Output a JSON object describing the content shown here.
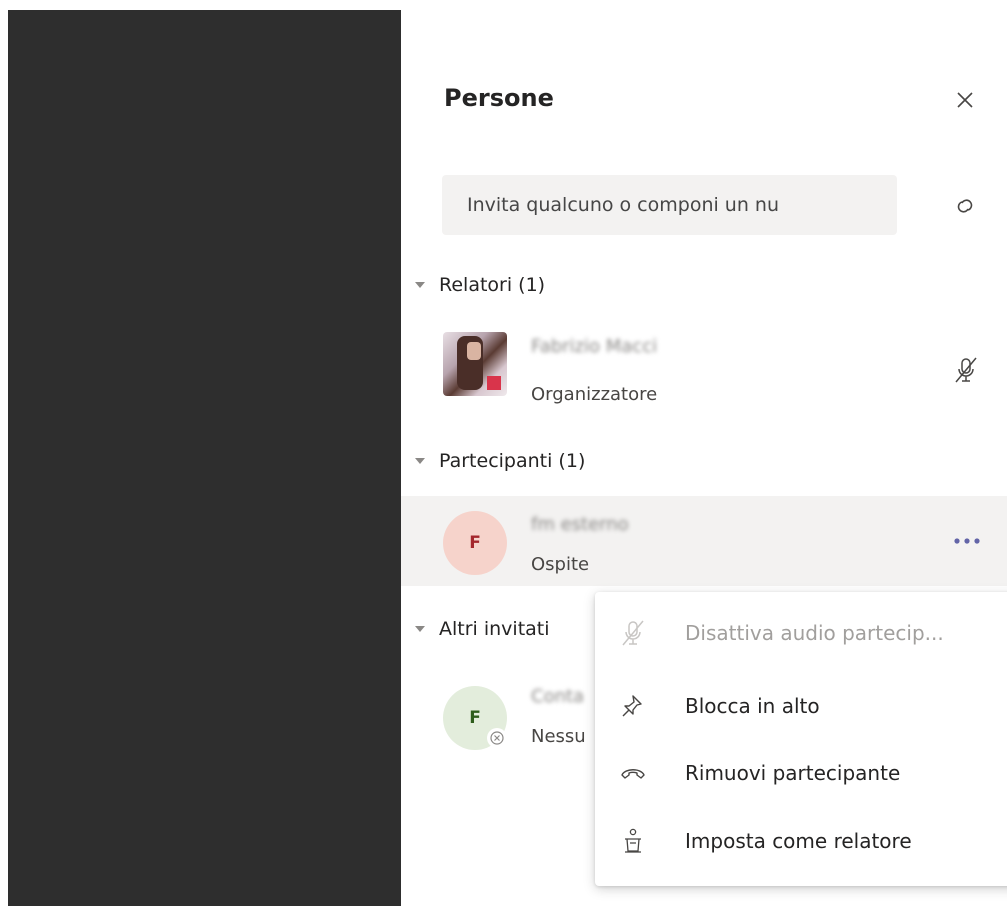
{
  "panel": {
    "title": "Persone",
    "search_placeholder": "Invita qualcuno o componi un nu"
  },
  "sections": {
    "presenters": {
      "label": "Relatori (1)"
    },
    "attendees": {
      "label": "Partecipanti (1)"
    },
    "others": {
      "label": "Altri invitati"
    }
  },
  "presenter": {
    "name": "Fabrizio Macci",
    "role": "Organizzatore"
  },
  "attendee": {
    "initial": "F",
    "name": "fm esterno",
    "role": "Ospite"
  },
  "other_invitee": {
    "initial": "F",
    "name": "Conta",
    "role": "Nessu"
  },
  "context_menu": {
    "items": [
      {
        "label": "Disattiva audio partecip...",
        "icon": "mic-off-icon",
        "disabled": true
      },
      {
        "label": "Blocca in alto",
        "icon": "pin-icon",
        "disabled": false
      },
      {
        "label": "Rimuovi partecipante",
        "icon": "hang-up-icon",
        "disabled": false
      },
      {
        "label": "Imposta come relatore",
        "icon": "podium-icon",
        "disabled": false
      }
    ]
  },
  "colors": {
    "dark_pane": "#2e2e2e",
    "accent": "#6264a7",
    "attendee_avatar_bg": "#f6d3cb",
    "attendee_avatar_fg": "#a4262c",
    "other_avatar_bg": "#e3eddc",
    "other_avatar_fg": "#2e5d1c"
  }
}
